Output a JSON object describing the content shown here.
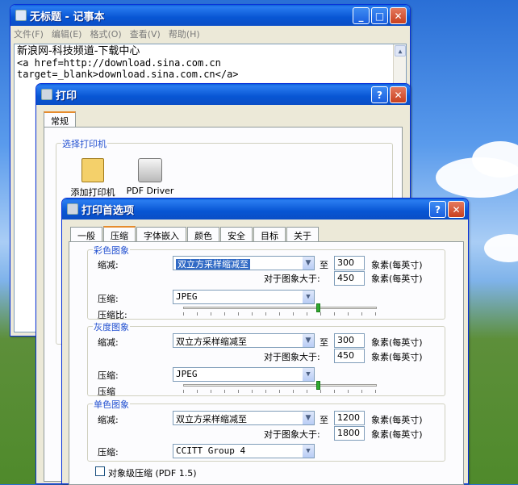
{
  "notepad": {
    "title": "无标题 - 记事本",
    "menu": [
      "文件(F)",
      "编辑(E)",
      "格式(O)",
      "查看(V)",
      "帮助(H)"
    ],
    "lines": [
      "新浪网-科技频道-下载中心",
      "<a href=http://download.sina.com.cn",
      "target=_blank>download.sina.com.cn</a>"
    ]
  },
  "print_dialog": {
    "title": "打印",
    "tab": "常规",
    "group_label": "选择打印机",
    "printers": [
      "添加打印机",
      "PDF Driver"
    ]
  },
  "prefs_dialog": {
    "title": "打印首选项",
    "tabs": [
      "一般",
      "压缩",
      "字体嵌入",
      "颜色",
      "安全",
      "目标",
      "关于"
    ],
    "active_tab": "压缩",
    "color": {
      "label": "彩色图象",
      "reduce_label": "缩减:",
      "method": "双立方采样缩减至",
      "to": "至",
      "dpi": "300",
      "dpi_unit": "象素(每英寸)",
      "above_label": "对于图象大于:",
      "above": "450",
      "above_unit": "象素(每英寸)",
      "compress_label": "压缩:",
      "compress": "JPEG",
      "ratio_label": "压缩比:",
      "ratio": 0.7
    },
    "gray": {
      "label": "灰度图象",
      "reduce_label": "缩减:",
      "method": "双立方采样缩减至",
      "to": "至",
      "dpi": "300",
      "dpi_unit": "象素(每英寸)",
      "above_label": "对于图象大于:",
      "above": "450",
      "above_unit": "象素(每英寸)",
      "compress_label": "压缩:",
      "compress": "JPEG",
      "ratio_label": "压缩",
      "ratio": 0.7
    },
    "mono": {
      "label": "单色图象",
      "reduce_label": "缩减:",
      "method": "双立方采样缩减至",
      "to": "至",
      "dpi": "1200",
      "dpi_unit": "象素(每英寸)",
      "above_label": "对于图象大于:",
      "above": "1800",
      "above_unit": "象素(每英寸)",
      "compress_label": "压缩:",
      "compress": "CCITT Group 4"
    },
    "object_compress": "对象级压缩 (PDF 1.5)"
  }
}
